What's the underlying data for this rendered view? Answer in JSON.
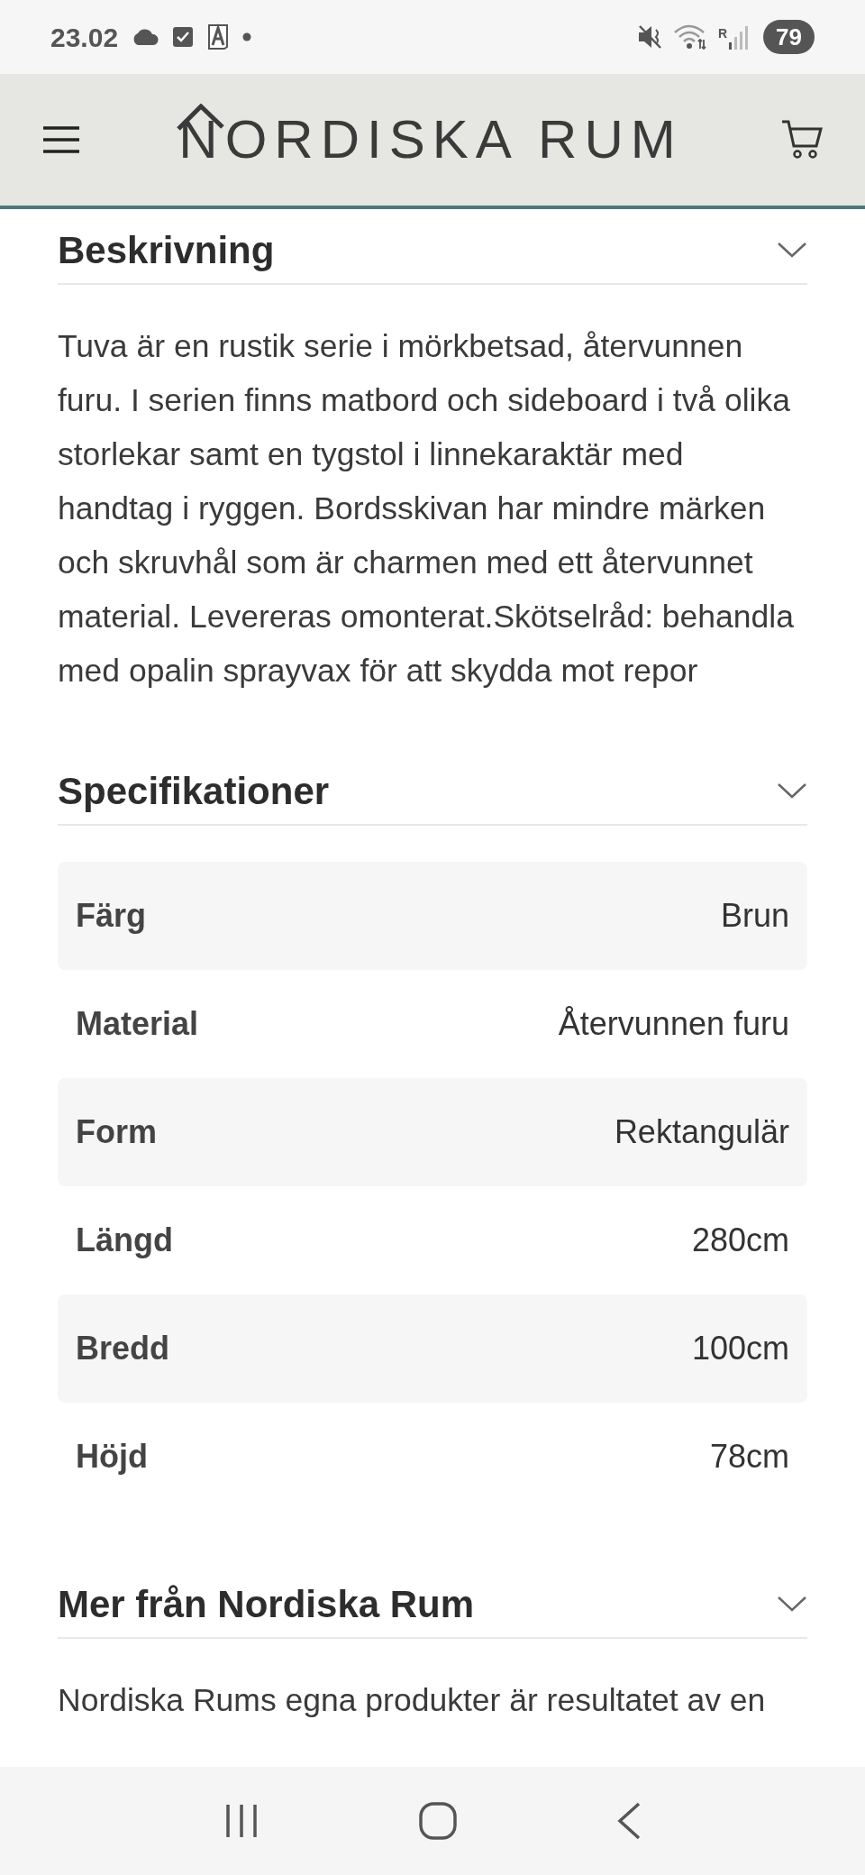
{
  "status_bar": {
    "time": "23.02",
    "network_letter": "R",
    "battery": "79"
  },
  "header": {
    "logo": "NORDISKA RUM"
  },
  "sections": [
    {
      "kind": "text",
      "title": "Beskrivning",
      "expanded": true,
      "text": "Tuva är en rustik serie i mörkbetsad, återvunnen furu. I serien finns matbord och sideboard i två olika storlekar samt en tygstol i linnekaraktär med handtag i ryggen. Bordsskivan har mindre märken och skruvhål som är charmen med ett återvunnet material. Levereras omonterat.Skötselråd: behandla med opalin sprayvax för att skydda mot repor"
    },
    {
      "kind": "specs",
      "title": "Specifikationer",
      "expanded": true,
      "rows": [
        {
          "label": "Färg",
          "value": "Brun"
        },
        {
          "label": "Material",
          "value": "Återvunnen furu"
        },
        {
          "label": "Form",
          "value": "Rektangulär"
        },
        {
          "label": "Längd",
          "value": "280cm"
        },
        {
          "label": "Bredd",
          "value": "100cm"
        },
        {
          "label": "Höjd",
          "value": "78cm"
        }
      ]
    },
    {
      "kind": "text",
      "title": "Mer från Nordiska Rum",
      "expanded": true,
      "text": "Nordiska Rums egna produkter är resultatet av en"
    }
  ]
}
